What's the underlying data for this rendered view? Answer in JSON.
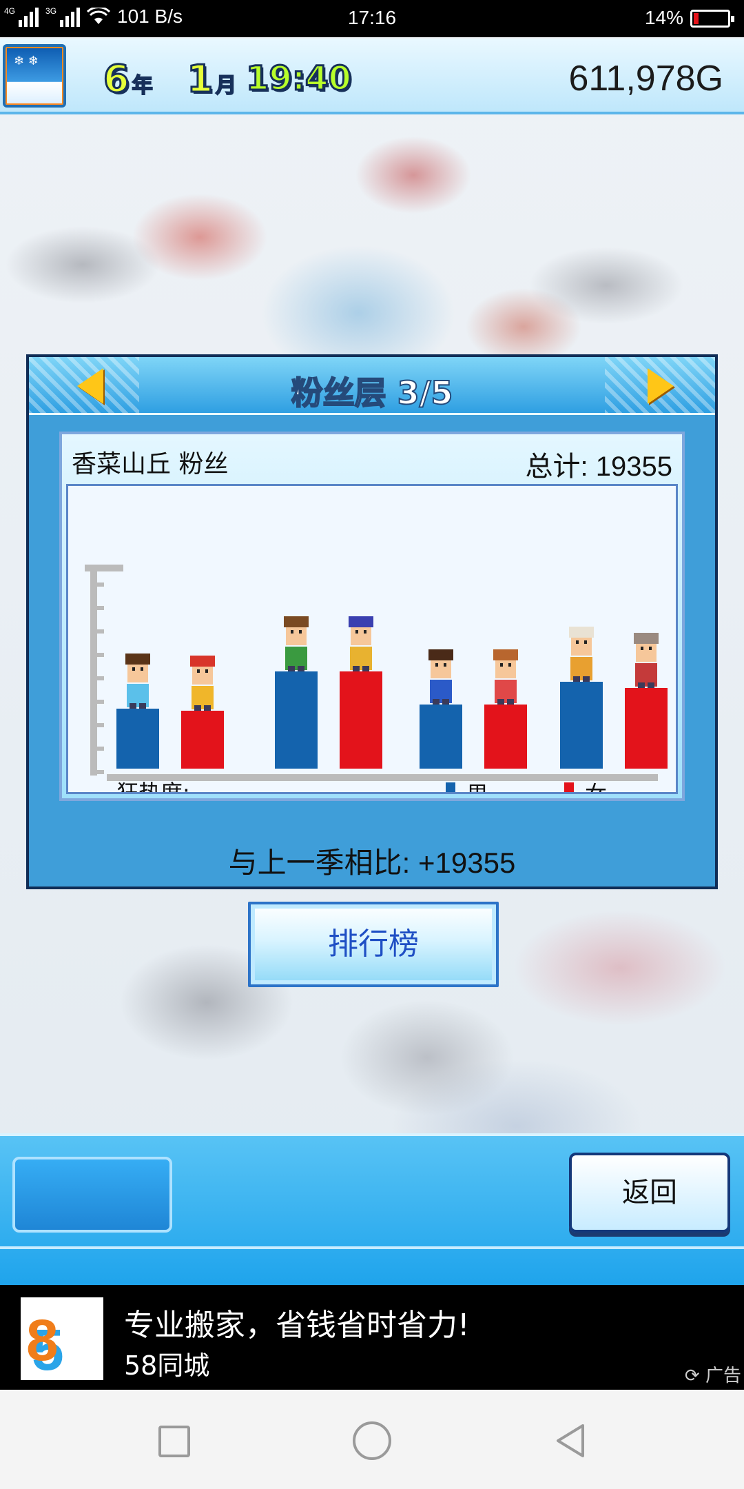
{
  "status_bar": {
    "network_a": "4G",
    "network_b": "3G",
    "speed": "101 B/s",
    "time": "17:16",
    "battery_pct": "14%",
    "battery_level": 0.14,
    "battery_color": "#e5141b"
  },
  "hud": {
    "year": "6",
    "year_unit": "年",
    "month": "1",
    "month_unit": "月",
    "clock": "19:40",
    "money": "611,978G"
  },
  "fan_panel": {
    "title": "粉丝层 3/5",
    "resort_name": "香菜山丘 粉丝",
    "total": "总计: 19355",
    "compare": "与上一季相比: +19355",
    "legend": {
      "male": "男",
      "female": "女",
      "male_color": "#1463ad",
      "female_color": "#e3131b"
    }
  },
  "chart_data": {
    "type": "bar",
    "xlabel": "狂热度:",
    "categories": [
      "child",
      "young",
      "adult",
      "senior"
    ],
    "series": [
      {
        "name": "男",
        "values": [
          0.29,
          0.47,
          0.31,
          0.42
        ]
      },
      {
        "name": "女",
        "values": [
          0.28,
          0.47,
          0.31,
          0.39
        ]
      }
    ],
    "ylim": [
      0,
      1
    ]
  },
  "rank_button": {
    "label": "排行榜"
  },
  "back_button": {
    "label": "返回"
  },
  "ad": {
    "logo": "58",
    "title": "专业搬家，省钱省时省力!",
    "subtitle": "58同城",
    "tag": "广告"
  }
}
